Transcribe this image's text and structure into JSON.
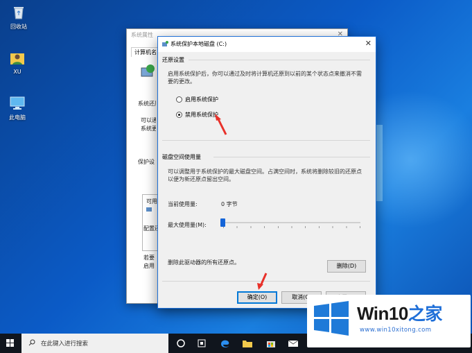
{
  "desktop": {
    "icons": [
      {
        "label": "回收站",
        "icon": "recycle-bin-icon"
      },
      {
        "label": "XU",
        "icon": "user-folder-icon"
      },
      {
        "label": "此电脑",
        "icon": "computer-icon"
      }
    ]
  },
  "back_window": {
    "title": "系统属性",
    "tab": "计算机名",
    "fragments": [
      "系统还原",
      "可以通",
      "系统更",
      "保护设",
      "可用",
      "配置还",
      "若要",
      "启用"
    ]
  },
  "dialog": {
    "title": "系统保护本地磁盘 (C:)",
    "restore_section": {
      "heading": "还原设置",
      "description_line1": "启用系统保护后，你可以通过及时将计算机还原到以前的某个状态点来撤消不需",
      "description_line2": "要的更改。",
      "options": [
        {
          "label": "启用系统保护",
          "selected": false
        },
        {
          "label": "禁用系统保护",
          "selected": true
        }
      ]
    },
    "disk_section": {
      "heading": "磁盘空间使用量",
      "description_line1": "可以调整用于系统保护的最大磁盘空间。占满空间时，系统将删除较旧的还原点",
      "description_line2": "以便为新还原点留出空间。",
      "current_usage_label": "当前使用量:",
      "current_usage_value": "0 字节",
      "max_usage_label": "最大使用量(M):",
      "max_usage_fraction": 0.0,
      "delete_text": "删除此驱动器的所有还原点。",
      "delete_button": "删除(D)"
    },
    "buttons": {
      "ok": "确定(O)",
      "cancel": "取消(C)",
      "apply": "应用(A)"
    }
  },
  "taskbar": {
    "search_placeholder": "在此键入进行搜索",
    "icons": [
      "start-icon",
      "task-view-icon",
      "widgets-icon",
      "edge-icon",
      "file-explorer-icon",
      "store-icon",
      "mail-icon"
    ]
  },
  "watermark": {
    "brand_text": "Win10",
    "brand_zh": "之家",
    "url": "www.win10xitong.com"
  },
  "colors": {
    "accent": "#0078d7",
    "arrow": "#e8312a",
    "desktop_blue": "#0b5bc7"
  }
}
